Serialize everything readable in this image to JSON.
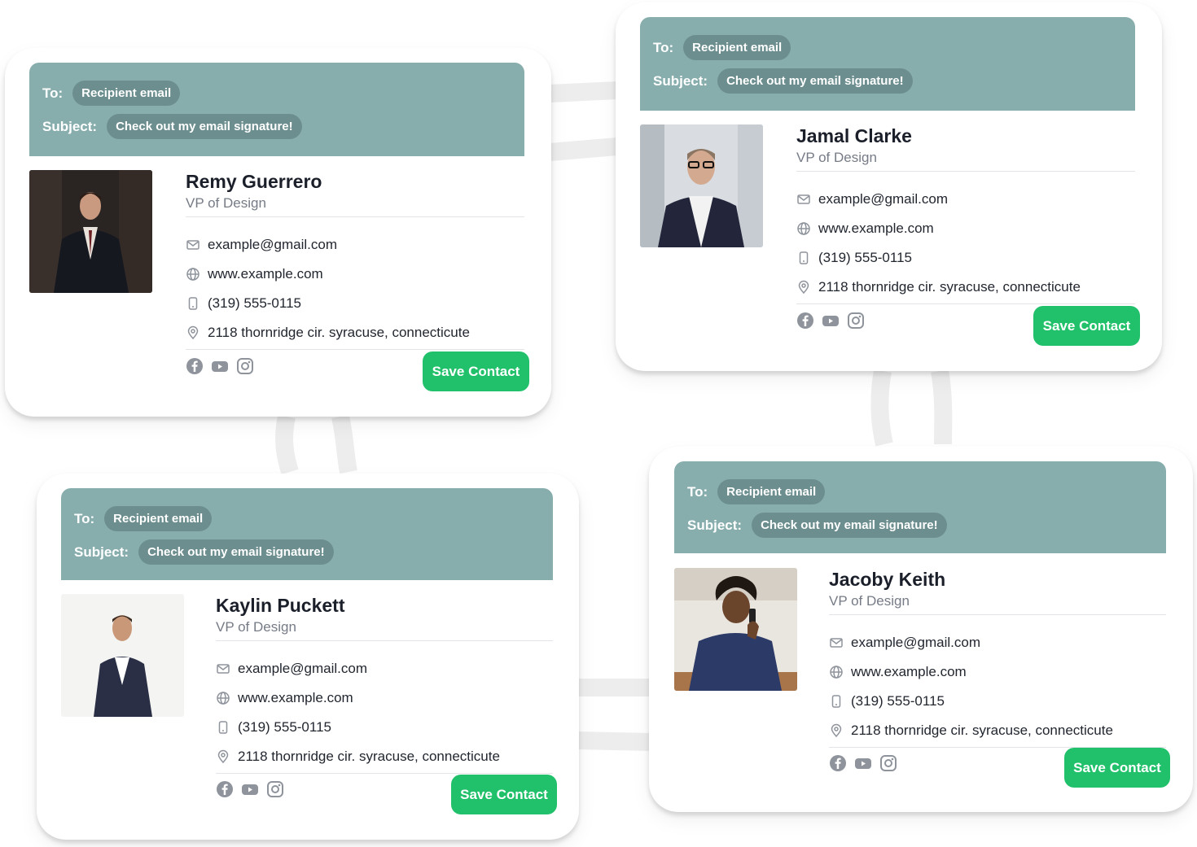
{
  "colors": {
    "header_bg": "#87adad",
    "pill_bg": "#6c8e8f",
    "save_button_bg": "#21c06a",
    "icon_gray": "#8f949c"
  },
  "labels": {
    "to": "To:",
    "subject": "Subject:"
  },
  "cards": [
    {
      "to_value": "Recipient email",
      "subject_value": "Check out my email signature!",
      "name": "Remy Guerrero",
      "role": "VP of Design",
      "email": "example@gmail.com",
      "website": "www.example.com",
      "phone": "(319) 555-0115",
      "address": "2118 thornridge cir. syracuse, connecticute",
      "save_label": "Save Contact",
      "social_icons": [
        "facebook-icon",
        "youtube-icon",
        "instagram-icon"
      ]
    },
    {
      "to_value": "Recipient email",
      "subject_value": "Check out my email signature!",
      "name": "Jamal Clarke",
      "role": "VP of Design",
      "email": "example@gmail.com",
      "website": "www.example.com",
      "phone": "(319) 555-0115",
      "address": "2118 thornridge cir. syracuse, connecticute",
      "save_label": "Save Contact",
      "social_icons": [
        "facebook-icon",
        "youtube-icon",
        "instagram-icon"
      ]
    },
    {
      "to_value": "Recipient email",
      "subject_value": "Check out my email signature!",
      "name": "Kaylin Puckett",
      "role": "VP of Design",
      "email": "example@gmail.com",
      "website": "www.example.com",
      "phone": "(319) 555-0115",
      "address": "2118 thornridge cir. syracuse, connecticute",
      "save_label": "Save Contact",
      "social_icons": [
        "facebook-icon",
        "youtube-icon",
        "instagram-icon"
      ]
    },
    {
      "to_value": "Recipient email",
      "subject_value": "Check out my email signature!",
      "name": "Jacoby Keith",
      "role": "VP of Design",
      "email": "example@gmail.com",
      "website": "www.example.com",
      "phone": "(319) 555-0115",
      "address": "2118 thornridge cir. syracuse, connecticute",
      "save_label": "Save Contact",
      "social_icons": [
        "facebook-icon",
        "youtube-icon",
        "instagram-icon"
      ]
    }
  ]
}
